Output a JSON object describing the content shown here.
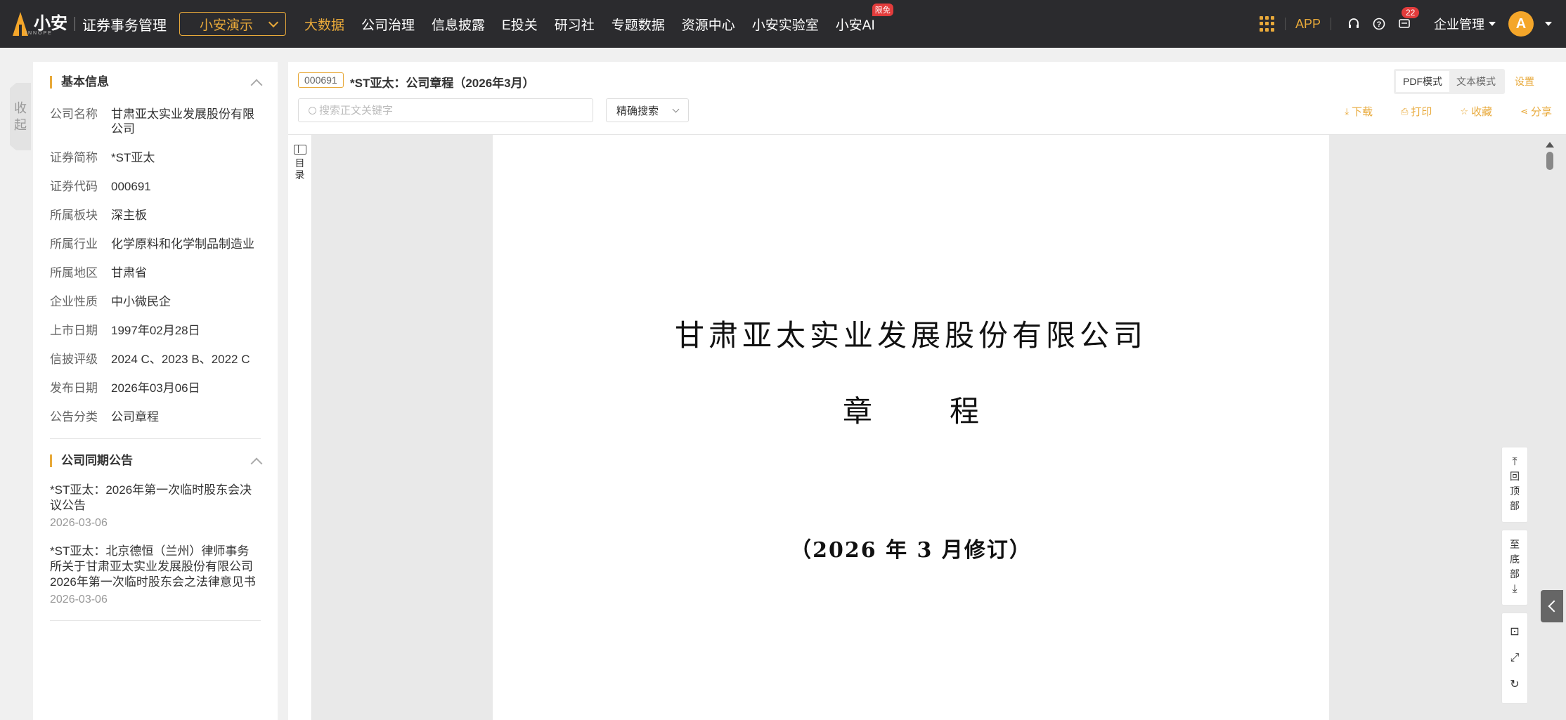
{
  "header": {
    "logo_text": "小安",
    "logo_sub": "INNOPE",
    "app_title": "证券事务管理",
    "demo_select": "小安演示",
    "nav": [
      {
        "label": "大数据",
        "active": true
      },
      {
        "label": "公司治理"
      },
      {
        "label": "信息披露"
      },
      {
        "label": "E投关"
      },
      {
        "label": "研习社"
      },
      {
        "label": "专题数据"
      },
      {
        "label": "资源中心"
      },
      {
        "label": "小安实验室"
      },
      {
        "label": "小安AI",
        "badge": "限免"
      }
    ],
    "app_label": "APP",
    "message_count": "22",
    "enterprise_label": "企业管理",
    "avatar_letter": "A"
  },
  "collapse_label": [
    "收",
    "起"
  ],
  "basic_info": {
    "title": "基本信息",
    "rows": [
      {
        "label": "公司名称",
        "value": "甘肃亚太实业发展股份有限公司"
      },
      {
        "label": "证券简称",
        "value": "*ST亚太"
      },
      {
        "label": "证券代码",
        "value": "000691"
      },
      {
        "label": "所属板块",
        "value": "深主板"
      },
      {
        "label": "所属行业",
        "value": "化学原料和化学制品制造业"
      },
      {
        "label": "所属地区",
        "value": "甘肃省"
      },
      {
        "label": "企业性质",
        "value": "中小微民企"
      },
      {
        "label": "上市日期",
        "value": "1997年02月28日"
      },
      {
        "label": "信披评级",
        "value": "2024 C、2023 B、2022 C"
      },
      {
        "label": "发布日期",
        "value": "2026年03月06日"
      },
      {
        "label": "公告分类",
        "value": "公司章程"
      }
    ]
  },
  "announcements": {
    "title": "公司同期公告",
    "items": [
      {
        "title": "*ST亚太：2026年第一次临时股东会决议公告",
        "date": "2026-03-06"
      },
      {
        "title": "*ST亚太：北京德恒（兰州）律师事务所关于甘肃亚太实业发展股份有限公司2026年第一次临时股东会之法律意见书",
        "date": "2026-03-06"
      }
    ]
  },
  "document": {
    "code": "000691",
    "title": "*ST亚太：公司章程（2026年3月）",
    "mode_pdf": "PDF模式",
    "mode_text": "文本模式",
    "settings": "设置",
    "search_placeholder": "搜索正文关键字",
    "search_mode": "精确搜索",
    "actions": {
      "download": "下载",
      "print": "打印",
      "favorite": "收藏",
      "share": "分享"
    },
    "toc_label": [
      "目",
      "录"
    ],
    "page": {
      "company": "甘肃亚太实业发展股份有限公司",
      "doc_type": "章程",
      "revision": "（2026 年 3 月修订）"
    }
  },
  "float_tools": {
    "to_top": [
      "回",
      "顶",
      "部"
    ],
    "to_bottom": [
      "至",
      "底",
      "部"
    ]
  },
  "colors": {
    "accent": "#e8a93a",
    "topbar": "#2b2b2e",
    "badge": "#e23c3c"
  }
}
